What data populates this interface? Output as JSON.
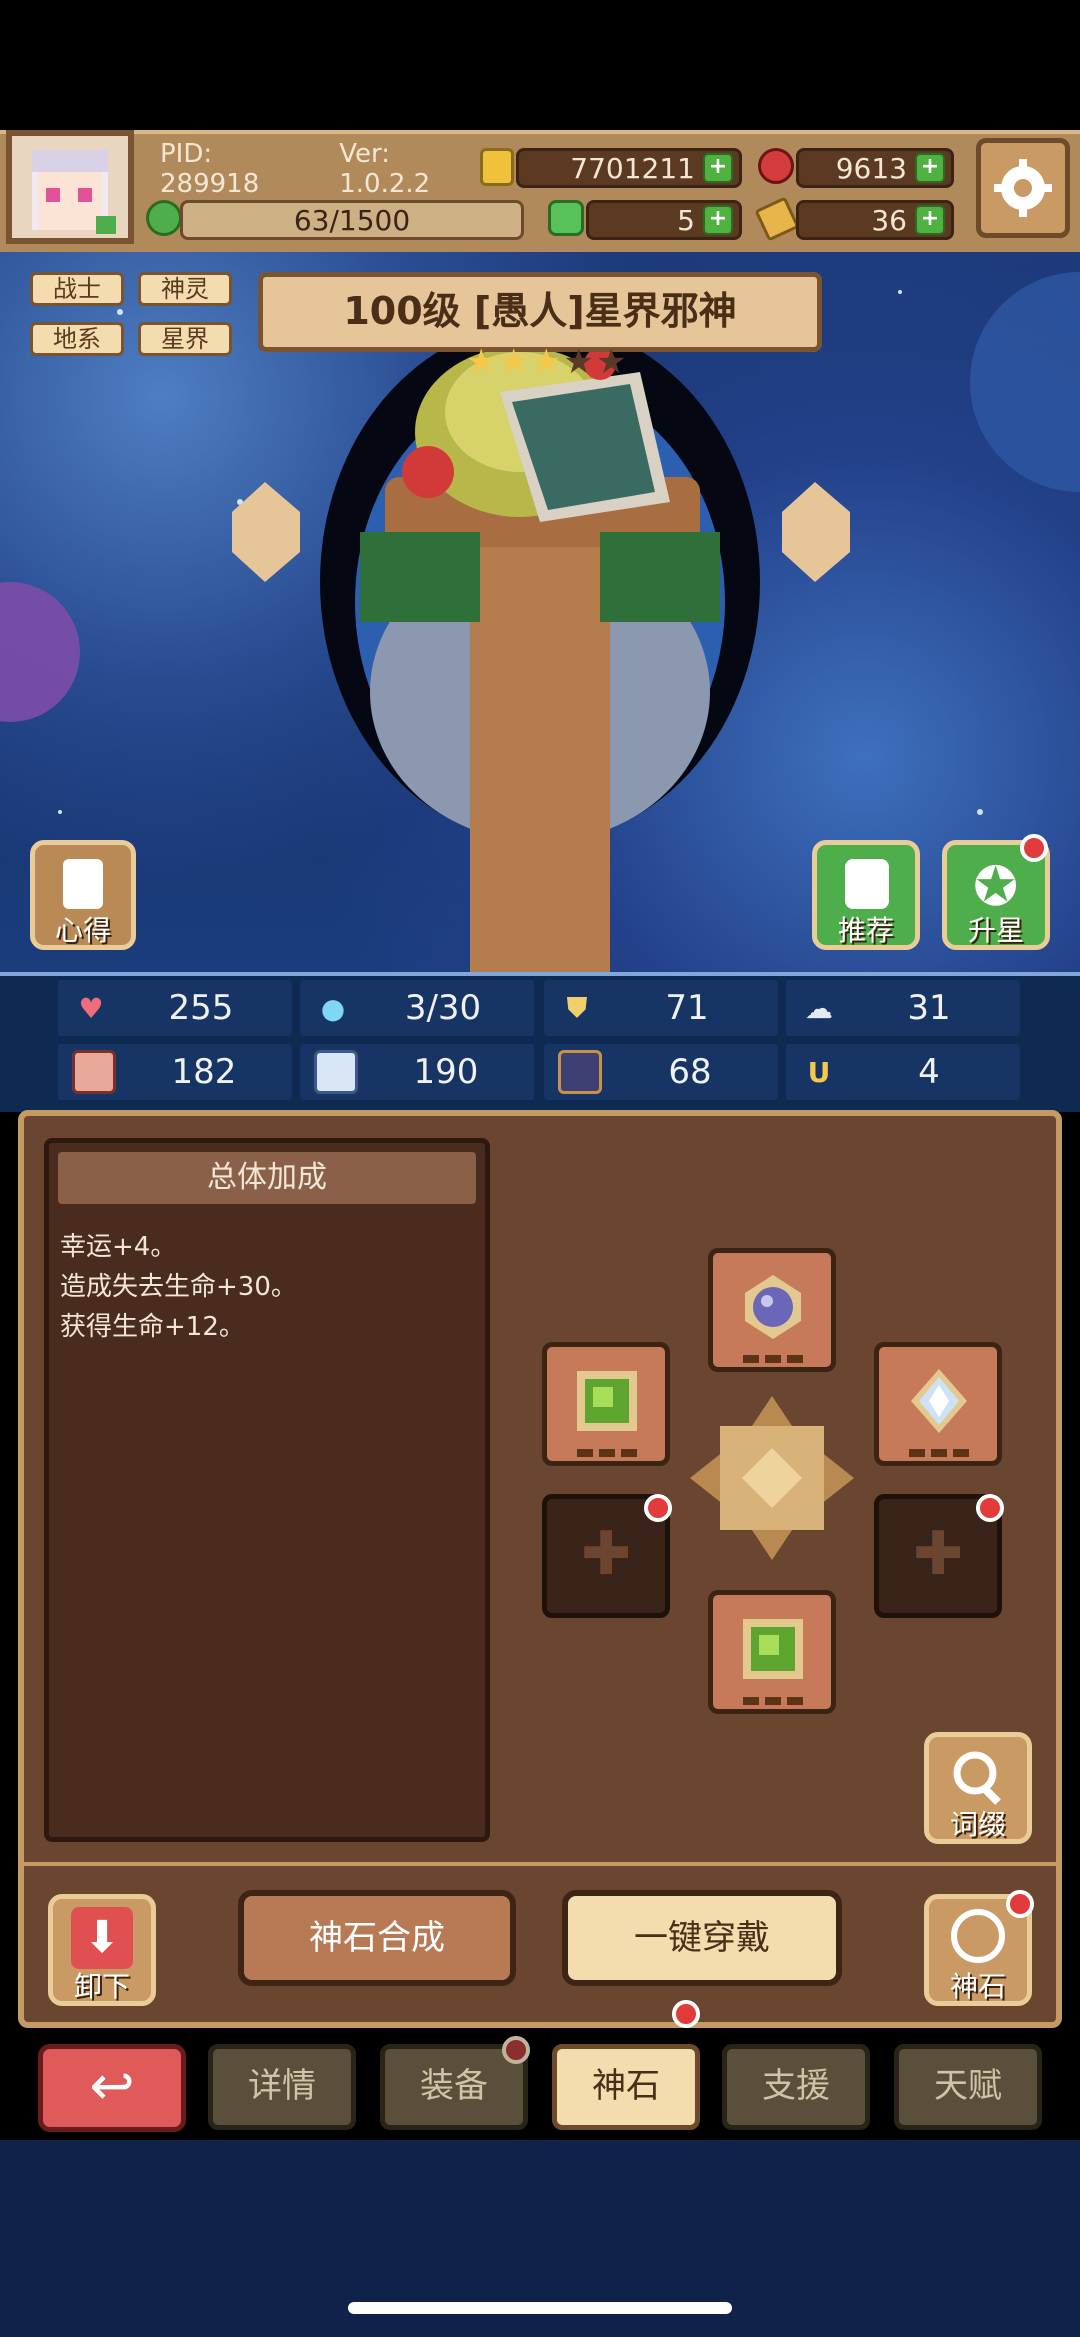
{
  "hud": {
    "pid": "PID: 289918",
    "version": "Ver: 1.0.2.2",
    "gold": "7701211",
    "ruby": "9613",
    "stamina": "63/1500",
    "clover": "5",
    "key": "36"
  },
  "hero": {
    "tags": [
      "战士",
      "神灵",
      "地系",
      "星界"
    ],
    "title": "100级 [愚人]星界邪神",
    "stars_filled": 3,
    "stars_total": 5
  },
  "scene_buttons": {
    "left": "心得",
    "recommend": "推荐",
    "star_up": "升星"
  },
  "stats": [
    {
      "icon": "heart-icon",
      "value": "255"
    },
    {
      "icon": "water-drop-icon",
      "value": "3/30"
    },
    {
      "icon": "shield-icon",
      "value": "71"
    },
    {
      "icon": "wing-icon",
      "value": "31"
    },
    {
      "icon": "fist-icon",
      "value": "182"
    },
    {
      "icon": "book-icon",
      "value": "190"
    },
    {
      "icon": "boot-icon",
      "value": "68"
    },
    {
      "icon": "horseshoe-icon",
      "value": "4"
    }
  ],
  "bonus_panel": {
    "title": "总体加成",
    "lines": [
      "幸运+4。",
      "造成失去生命+30。",
      "获得生命+12。"
    ]
  },
  "affix_button": "词缀",
  "actions": {
    "unequip": "卸下",
    "combine": "神石合成",
    "equip_all": "一键穿戴",
    "stone": "神石"
  },
  "tabs": [
    "详情",
    "装备",
    "神石",
    "支援",
    "天赋"
  ],
  "colors": {
    "accent_brown": "#7a5431",
    "panel_bg": "#6a4631",
    "active_tab": "#f3dcae",
    "red_badge": "#e23b3b",
    "plus_green": "#4fb13f"
  }
}
